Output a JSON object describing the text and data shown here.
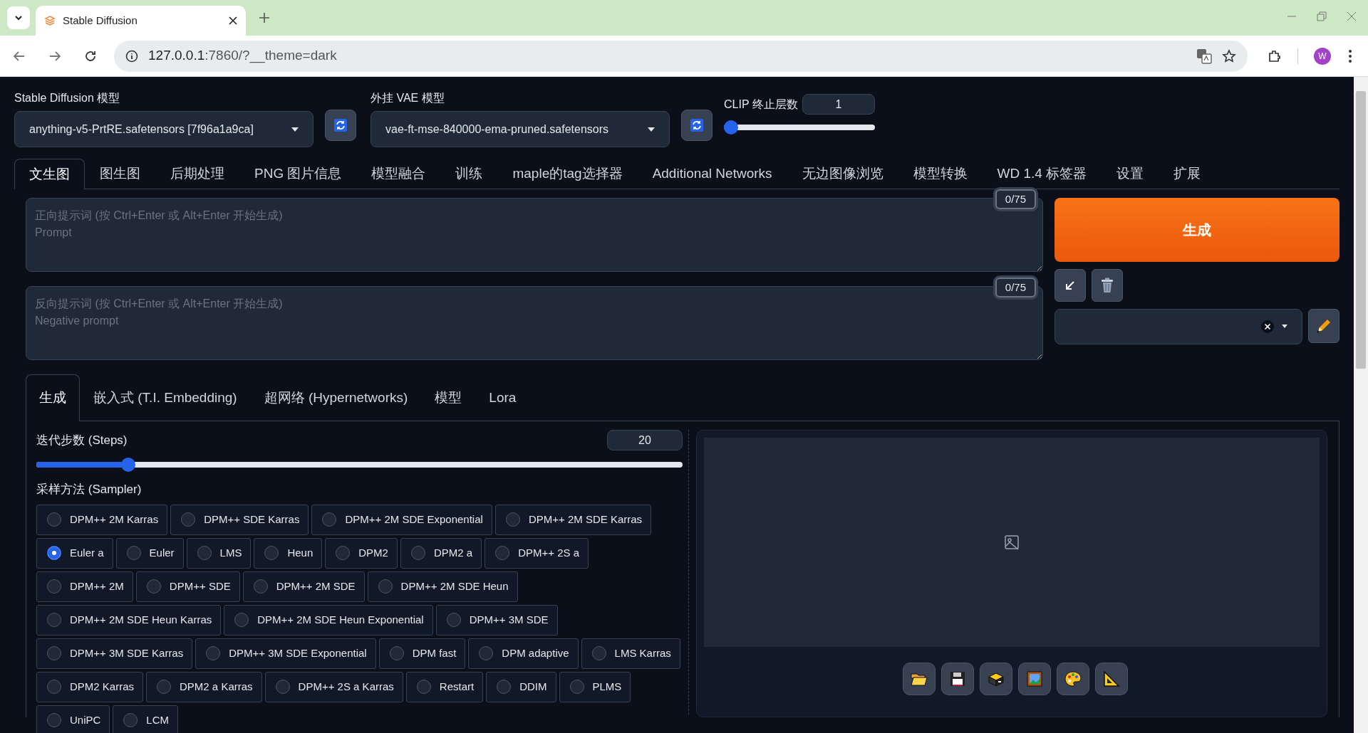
{
  "browser": {
    "tab_title": "Stable Diffusion",
    "url_host": "127.0.0.1",
    "url_path": ":7860/?__theme=dark",
    "profile_initial": "W"
  },
  "model": {
    "label": "Stable Diffusion 模型",
    "value": "anything-v5-PrtRE.safetensors [7f96a1a9ca]"
  },
  "vae": {
    "label": "外挂 VAE 模型",
    "value": "vae-ft-mse-840000-ema-pruned.safetensors"
  },
  "clip": {
    "label": "CLIP 终止层数",
    "value": "1",
    "level": 0
  },
  "tabs": [
    {
      "label": "文生图",
      "selected": true
    },
    {
      "label": "图生图",
      "selected": false
    },
    {
      "label": "后期处理",
      "selected": false
    },
    {
      "label": "PNG 图片信息",
      "selected": false
    },
    {
      "label": "模型融合",
      "selected": false
    },
    {
      "label": "训练",
      "selected": false
    },
    {
      "label": "maple的tag选择器",
      "selected": false
    },
    {
      "label": "Additional Networks",
      "selected": false
    },
    {
      "label": "无边图像浏览",
      "selected": false
    },
    {
      "label": "模型转换",
      "selected": false
    },
    {
      "label": "WD 1.4 标签器",
      "selected": false
    },
    {
      "label": "设置",
      "selected": false
    },
    {
      "label": "扩展",
      "selected": false
    }
  ],
  "prompt": {
    "placeholder": "正向提示词 (按 Ctrl+Enter 或 Alt+Enter 开始生成)\nPrompt",
    "counter": "0/75"
  },
  "negative_prompt": {
    "placeholder": "反向提示词 (按 Ctrl+Enter 或 Alt+Enter 开始生成)\nNegative prompt",
    "counter": "0/75"
  },
  "generate_button": "生成",
  "sub_tabs": [
    {
      "label": "生成",
      "selected": true
    },
    {
      "label": "嵌入式 (T.I. Embedding)",
      "selected": false
    },
    {
      "label": "超网络 (Hypernetworks)",
      "selected": false
    },
    {
      "label": "模型",
      "selected": false
    },
    {
      "label": "Lora",
      "selected": false
    }
  ],
  "steps": {
    "label": "迭代步数 (Steps)",
    "value": "20",
    "level": 0.134
  },
  "sampler": {
    "label": "采样方法 (Sampler)",
    "options": [
      {
        "label": "DPM++ 2M Karras",
        "selected": false
      },
      {
        "label": "DPM++ SDE Karras",
        "selected": false
      },
      {
        "label": "DPM++ 2M SDE Exponential",
        "selected": false
      },
      {
        "label": "DPM++ 2M SDE Karras",
        "selected": false
      },
      {
        "label": "Euler a",
        "selected": true
      },
      {
        "label": "Euler",
        "selected": false
      },
      {
        "label": "LMS",
        "selected": false
      },
      {
        "label": "Heun",
        "selected": false
      },
      {
        "label": "DPM2",
        "selected": false
      },
      {
        "label": "DPM2 a",
        "selected": false
      },
      {
        "label": "DPM++ 2S a",
        "selected": false
      },
      {
        "label": "DPM++ 2M",
        "selected": false
      },
      {
        "label": "DPM++ SDE",
        "selected": false
      },
      {
        "label": "DPM++ 2M SDE",
        "selected": false
      },
      {
        "label": "DPM++ 2M SDE Heun",
        "selected": false
      },
      {
        "label": "DPM++ 2M SDE Heun Karras",
        "selected": false
      },
      {
        "label": "DPM++ 2M SDE Heun Exponential",
        "selected": false
      },
      {
        "label": "DPM++ 3M SDE",
        "selected": false
      },
      {
        "label": "DPM++ 3M SDE Karras",
        "selected": false
      },
      {
        "label": "DPM++ 3M SDE Exponential",
        "selected": false
      },
      {
        "label": "DPM fast",
        "selected": false
      },
      {
        "label": "DPM adaptive",
        "selected": false
      },
      {
        "label": "LMS Karras",
        "selected": false
      },
      {
        "label": "DPM2 Karras",
        "selected": false
      },
      {
        "label": "DPM2 a Karras",
        "selected": false
      },
      {
        "label": "DPM++ 2S a Karras",
        "selected": false
      },
      {
        "label": "Restart",
        "selected": false
      },
      {
        "label": "DDIM",
        "selected": false
      },
      {
        "label": "PLMS",
        "selected": false
      },
      {
        "label": "UniPC",
        "selected": false
      },
      {
        "label": "LCM",
        "selected": false
      }
    ]
  }
}
